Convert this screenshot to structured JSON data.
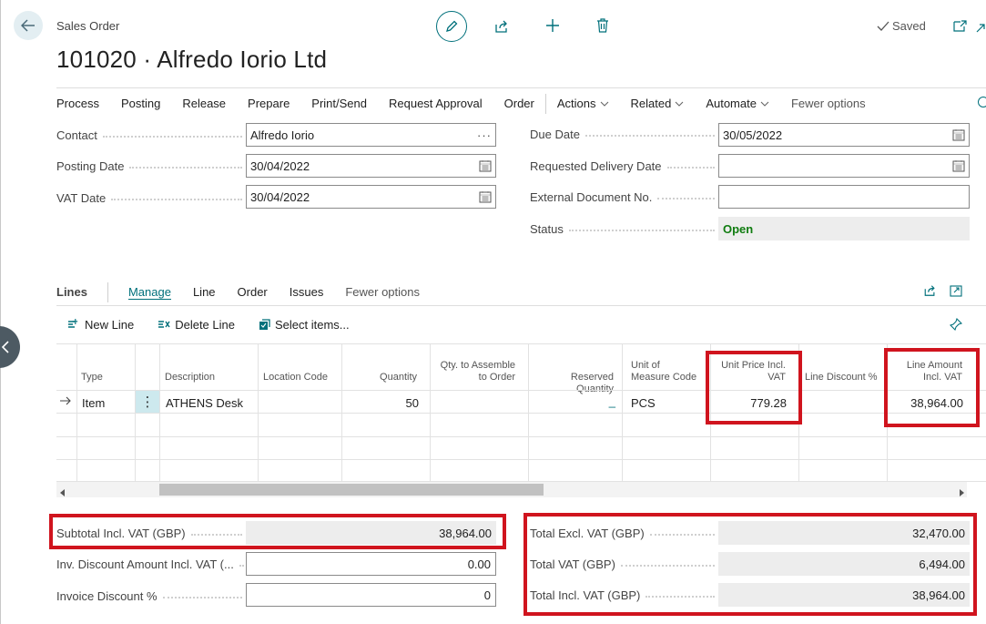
{
  "header": {
    "doc_type": "Sales Order",
    "title": "101020 · Alfredo Iorio Ltd",
    "saved_label": "Saved"
  },
  "menu": {
    "items": [
      "Process",
      "Posting",
      "Release",
      "Prepare",
      "Print/Send",
      "Request Approval",
      "Order"
    ],
    "dropdowns": [
      "Actions",
      "Related",
      "Automate"
    ],
    "fewer_options": "Fewer options"
  },
  "general": {
    "contact_label": "Contact",
    "contact_value": "Alfredo Iorio",
    "contact_more": "···",
    "posting_date_label": "Posting Date",
    "posting_date_value": "30/04/2022",
    "vat_date_label": "VAT Date",
    "vat_date_value": "30/04/2022",
    "due_date_label": "Due Date",
    "due_date_value": "30/05/2022",
    "req_delivery_label": "Requested Delivery Date",
    "req_delivery_value": "",
    "ext_doc_label": "External Document No.",
    "ext_doc_value": "",
    "status_label": "Status",
    "status_value": "Open"
  },
  "lines": {
    "title": "Lines",
    "tabs": [
      "Manage",
      "Line",
      "Order",
      "Issues",
      "Fewer options"
    ],
    "actions": [
      "New Line",
      "Delete Line",
      "Select items..."
    ],
    "columns": {
      "type": "Type",
      "description": "Description",
      "location": "Location Code",
      "quantity": "Quantity",
      "assemble_1": "Qty. to Assemble",
      "assemble_2": "to Order",
      "reserved": "Reserved Quantity",
      "uom_1": "Unit of",
      "uom_2": "Measure Code",
      "price_1": "Unit Price Incl.",
      "price_2": "VAT",
      "discount": "Line Discount %",
      "amount_1": "Line Amount",
      "amount_2": "Incl. VAT"
    },
    "row": {
      "type": "Item",
      "menu_dots": "⋮",
      "description": "ATHENS Desk",
      "location": "",
      "quantity": "50",
      "assemble": "",
      "reserved": "_",
      "uom": "PCS",
      "price": "779.28",
      "discount": "",
      "amount": "38,964.00"
    }
  },
  "totals": {
    "subtotal_label": "Subtotal Incl. VAT (GBP)",
    "subtotal_value": "38,964.00",
    "inv_disc_amount_label": "Inv. Discount Amount Incl. VAT (...",
    "inv_disc_amount_value": "0.00",
    "inv_disc_pct_label": "Invoice Discount %",
    "inv_disc_pct_value": "0",
    "total_excl_label": "Total Excl. VAT (GBP)",
    "total_excl_value": "32,470.00",
    "total_vat_label": "Total VAT (GBP)",
    "total_vat_value": "6,494.00",
    "total_incl_label": "Total Incl. VAT (GBP)",
    "total_incl_value": "38,964.00"
  },
  "colors": {
    "accent": "#00707b",
    "status_open": "#107c10",
    "highlight_red": "#d0141e"
  }
}
